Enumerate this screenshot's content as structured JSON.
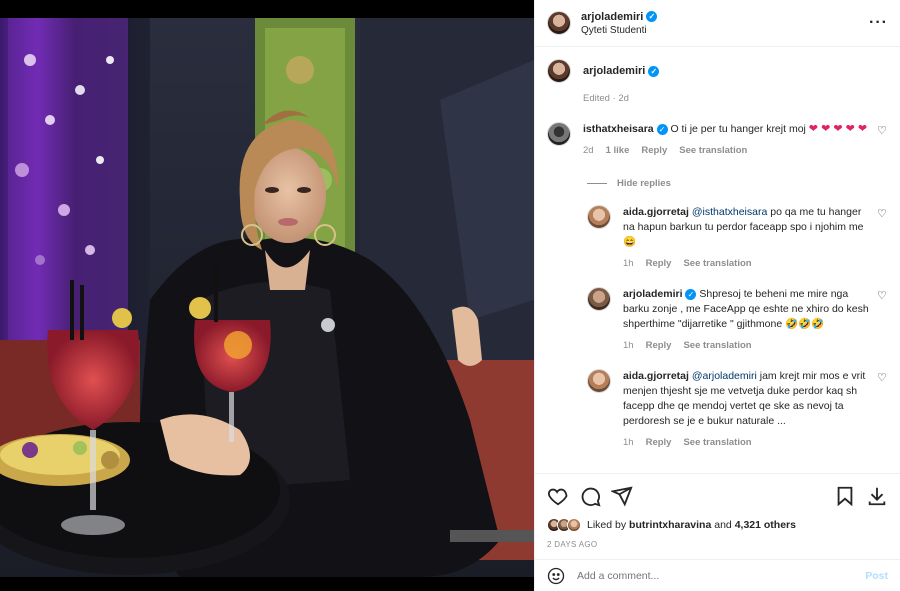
{
  "post": {
    "author": "arjolademiri",
    "location": "Qyteti Studenti",
    "caption_meta": "Edited · 2d"
  },
  "comments": [
    {
      "user": "isthatxheisara",
      "verified": true,
      "text": "O ti je per tu hanger krejt moj",
      "time": "2d",
      "likes": "1 like",
      "reply": "Reply",
      "translate": "See translation",
      "hide_replies": "Hide replies",
      "replies": [
        {
          "user": "aida.gjorretaj",
          "mention": "@isthatxheisara",
          "text": "po qa me tu hanger na hapun barkun tu perdor faceapp spo i njohim me 😄",
          "time": "1h",
          "reply": "Reply",
          "translate": "See translation"
        },
        {
          "user": "arjolademiri",
          "verified": true,
          "text": "Shpresoj te beheni me mire nga barku zonje , me FaceApp qe eshte ne xhiro do kesh shperthime \"dijarretike \" gjithmone 🤣🤣🤣",
          "time": "1h",
          "reply": "Reply",
          "translate": "See translation"
        },
        {
          "user": "aida.gjorretaj",
          "mention": "@arjolademiri",
          "text": "jam krejt mir mos e vrit menjen thjesht sje me vetvetja duke perdor kaq sh facepp dhe qe mendoj vertet qe ske as nevoj ta perdoresh se je e bukur naturale ...",
          "time": "1h",
          "reply": "Reply",
          "translate": "See translation"
        }
      ]
    }
  ],
  "actions": {
    "liked_by_prefix": "Liked by",
    "liked_by_user": "butrintxharavina",
    "and": "and",
    "likes_count": "4,321 others",
    "ago": "2 DAYS AGO",
    "add_comment_placeholder": "Add a comment...",
    "post_label": "Post"
  },
  "icons": {
    "like": "heart-icon",
    "comment": "comment-icon",
    "share": "send-icon",
    "save": "bookmark-icon",
    "download": "download-icon",
    "emoji": "emoji-icon",
    "more": "more-options-icon"
  },
  "colors": {
    "accent": "#0095f6",
    "muted": "#8e8e8e",
    "post_disabled": "#b2dffc",
    "heart_emoji": "#e0245e"
  }
}
